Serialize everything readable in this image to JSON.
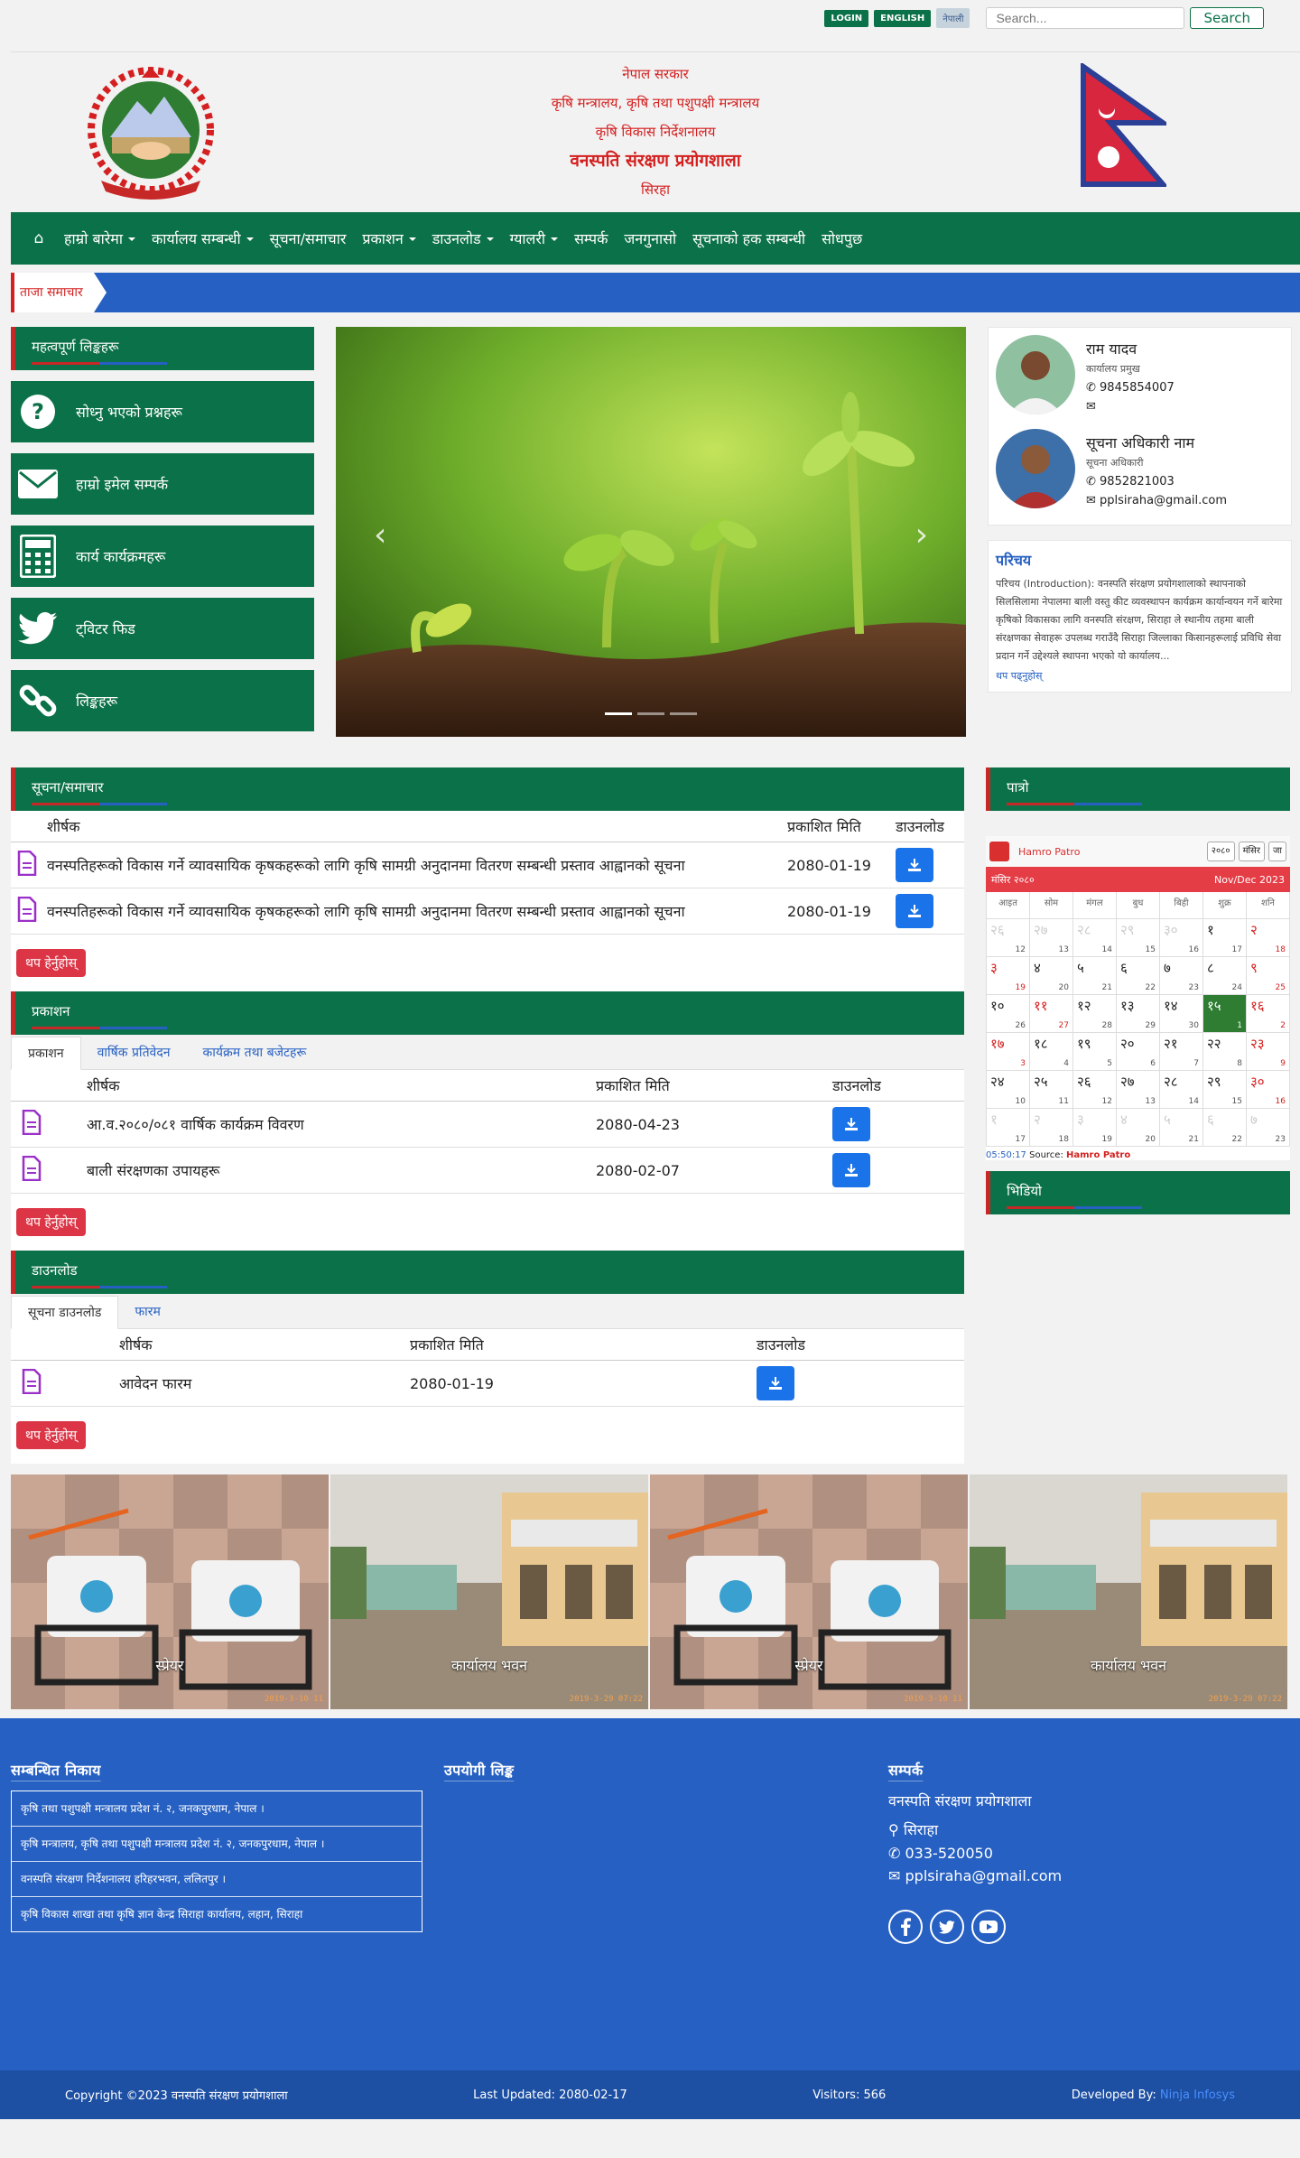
{
  "topbar": {
    "login": "LOGIN",
    "english": "ENGLISH",
    "nepali": "नेपाली",
    "search_placeholder": "Search...",
    "search_btn": "Search"
  },
  "header": {
    "line1": "नेपाल सरकार",
    "line2": "कृषि मन्त्रालय, कृषि तथा पशुपक्षी मन्त्रालय",
    "line3": "कृषि विकास निर्देशनालय",
    "line4": "वनस्पति संरक्षण प्रयोगशाला",
    "line5": "सिरहा"
  },
  "nav": [
    "गृहपृष्ठ",
    "हाम्रो बारेमा",
    "कार्यालय सम्बन्धी",
    "सूचना/समाचार",
    "प्रकाशन",
    "डाउनलोड",
    "ग्यालरी",
    "सम्पर्क",
    "जनगुनासो",
    "सूचनाको हक सम्बन्धी",
    "सोधपुछ"
  ],
  "ticker": {
    "tag": "ताजा समाचार"
  },
  "quick": {
    "title": "महत्वपूर्ण लिङ्कहरू",
    "items": [
      "सोध्नु भएको प्रश्नहरू",
      "हाम्रो इमेल सम्पर्क",
      "कार्य कार्यक्रमहरू",
      "ट्विटर फिड",
      "लिङ्कहरू"
    ]
  },
  "staff": [
    {
      "name": "राम यादव",
      "role": "कार्यालय प्रमुख",
      "phone": "9845854007",
      "email": ""
    },
    {
      "name": "सूचना अधिकारी नाम",
      "role": "सूचना अधिकारी",
      "phone": "9852821003",
      "email": "pplsiraha@gmail.com"
    }
  ],
  "intro": {
    "title": "परिचय",
    "text": "परिचय (Introduction): वनस्पति संरक्षण प्रयोगशालाको स्थापनाको सिलसिलामा नेपालमा बाली वस्तु कीट व्यवस्थापन कार्यक्रम कार्यान्वयन गर्ने बारेमा कृषिको विकासका लागि वनस्पति संरक्षण, सिराहा ले स्थानीय तहमा बाली संरक्षणका सेवाहरू उपलब्ध गराउँदै सिराहा जिल्लाका किसानहरूलाई प्रविधि सेवा प्रदान गर्ने उद्देश्यले स्थापना भएको यो कार्यालय...",
    "more": "थप पढ्नुहोस्"
  },
  "notices": {
    "title": "सूचना/समाचार",
    "headers": [
      "शीर्षक",
      "प्रकाशित मिति",
      "डाउनलोड"
    ],
    "rows": [
      {
        "title": "वनस्पतिहरूको विकास गर्ने व्यावसायिक कृषकहरूको लागि कृषि सामग्री अनुदानमा वितरण सम्बन्धी प्रस्ताव आह्वानको सूचना",
        "date": "2080-01-19"
      },
      {
        "title": "वनस्पतिहरूको विकास गर्ने व्यावसायिक कृषकहरूको लागि कृषि सामग्री अनुदानमा वितरण सम्बन्धी प्रस्ताव आह्वानको सूचना",
        "date": "2080-01-19"
      }
    ],
    "more": "थप हेर्नुहोस्"
  },
  "publications": {
    "title": "प्रकाशन",
    "tabs": [
      "प्रकाशन",
      "वार्षिक प्रतिवेदन",
      "कार्यक्रम तथा बजेटहरू"
    ],
    "headers": [
      "शीर्षक",
      "प्रकाशित मिति",
      "डाउनलोड"
    ],
    "rows": [
      {
        "title": "आ.व.२०८०/०८१ वार्षिक कार्यक्रम विवरण",
        "date": "2080-04-23"
      },
      {
        "title": "बाली संरक्षणका उपायहरू",
        "date": "2080-02-07"
      }
    ],
    "more": "थप हेर्नुहोस्"
  },
  "downloads": {
    "title": "डाउनलोड",
    "tabs": [
      "सूचना डाउनलोड",
      "फारम"
    ],
    "headers": [
      "शीर्षक",
      "प्रकाशित मिति",
      "डाउनलोड"
    ],
    "rows": [
      {
        "title": "आवेदन फारम",
        "date": "2080-01-19"
      }
    ],
    "more": "थप हेर्नुहोस्"
  },
  "calendar": {
    "title": "पात्रो",
    "brand": "Hamro Patro",
    "year_sel": "२०८०",
    "month_sel": "मंसिर",
    "go": "जा",
    "month_np": "मंसिर २०८०",
    "month_en": "Nov/Dec 2023",
    "weekdays": [
      "आइत",
      "सोम",
      "मंगल",
      "बुध",
      "बिही",
      "शुक्र",
      "शनि"
    ],
    "cells": [
      {
        "n": "२६",
        "e": "12",
        "t": "off"
      },
      {
        "n": "२७",
        "e": "13",
        "t": "off"
      },
      {
        "n": "२८",
        "e": "14",
        "t": "off"
      },
      {
        "n": "२९",
        "e": "15",
        "t": "off"
      },
      {
        "n": "३०",
        "e": "16",
        "t": "off"
      },
      {
        "n": "१",
        "e": "17",
        "t": ""
      },
      {
        "n": "२",
        "e": "18",
        "t": "sat"
      },
      {
        "n": "३",
        "e": "19",
        "t": "sat"
      },
      {
        "n": "४",
        "e": "20",
        "t": ""
      },
      {
        "n": "५",
        "e": "21",
        "t": ""
      },
      {
        "n": "६",
        "e": "22",
        "t": ""
      },
      {
        "n": "७",
        "e": "23",
        "t": ""
      },
      {
        "n": "८",
        "e": "24",
        "t": ""
      },
      {
        "n": "९",
        "e": "25",
        "t": "sat"
      },
      {
        "n": "१०",
        "e": "26",
        "t": ""
      },
      {
        "n": "११",
        "e": "27",
        "t": "sat"
      },
      {
        "n": "१२",
        "e": "28",
        "t": ""
      },
      {
        "n": "१३",
        "e": "29",
        "t": ""
      },
      {
        "n": "१४",
        "e": "30",
        "t": ""
      },
      {
        "n": "१५",
        "e": "1",
        "t": "today"
      },
      {
        "n": "१६",
        "e": "2",
        "t": "sat"
      },
      {
        "n": "१७",
        "e": "3",
        "t": "sat"
      },
      {
        "n": "१८",
        "e": "4",
        "t": ""
      },
      {
        "n": "१९",
        "e": "5",
        "t": ""
      },
      {
        "n": "२०",
        "e": "6",
        "t": ""
      },
      {
        "n": "२१",
        "e": "7",
        "t": ""
      },
      {
        "n": "२२",
        "e": "8",
        "t": ""
      },
      {
        "n": "२३",
        "e": "9",
        "t": "sat"
      },
      {
        "n": "२४",
        "e": "10",
        "t": ""
      },
      {
        "n": "२५",
        "e": "11",
        "t": ""
      },
      {
        "n": "२६",
        "e": "12",
        "t": ""
      },
      {
        "n": "२७",
        "e": "13",
        "t": ""
      },
      {
        "n": "२८",
        "e": "14",
        "t": ""
      },
      {
        "n": "२९",
        "e": "15",
        "t": ""
      },
      {
        "n": "३०",
        "e": "16",
        "t": "sat"
      },
      {
        "n": "१",
        "e": "17",
        "t": "off"
      },
      {
        "n": "२",
        "e": "18",
        "t": "off"
      },
      {
        "n": "३",
        "e": "19",
        "t": "off"
      },
      {
        "n": "४",
        "e": "20",
        "t": "off"
      },
      {
        "n": "५",
        "e": "21",
        "t": "off"
      },
      {
        "n": "६",
        "e": "22",
        "t": "off"
      },
      {
        "n": "७",
        "e": "23",
        "t": "off"
      }
    ],
    "time": "05:50:17",
    "source_label": "Source:",
    "source": "Hamro Patro"
  },
  "video": {
    "title": "भिडियो"
  },
  "gallery": [
    {
      "caption": "स्प्रेयर",
      "stamp": "2019-3-10 11"
    },
    {
      "caption": "कार्यालय भवन",
      "stamp": "2019-3-29 07:22"
    },
    {
      "caption": "स्प्रेयर",
      "stamp": "2019-3-10 11"
    },
    {
      "caption": "कार्यालय भवन",
      "stamp": "2019-3-29 07:22"
    }
  ],
  "footer": {
    "col1_title": "सम्बन्धित निकाय",
    "offices": [
      "कृषि तथा पशुपक्षी मन्त्रालय प्रदेश नं. २, जनकपुरधाम, नेपाल ।",
      "कृषि मन्त्रालय, कृषि तथा पशुपक्षी मन्त्रालय प्रदेश नं. २, जनकपुरधाम, नेपाल ।",
      "वनस्पति संरक्षण निर्देशनालय हरिहरभवन, ललितपुर ।",
      "कृषि विकास शाखा तथा कृषि ज्ञान केन्द्र सिराहा कार्यालय, लहान, सिराहा"
    ],
    "col2_title": "उपयोगी लिङ्क",
    "col3_title": "सम्पर्क",
    "org": "वनस्पति संरक्षण प्रयोगशाला",
    "address": "सिराहा",
    "phone": "033-520050",
    "email": "pplsiraha@gmail.com"
  },
  "copyright": {
    "text": "Copyright ©2023 वनस्पति संरक्षण प्रयोगशाला",
    "updated": "Last Updated: 2080-02-17",
    "visitors": "Visitors: 566",
    "dev_label": "Developed By:",
    "dev": "Ninja Infosys"
  }
}
